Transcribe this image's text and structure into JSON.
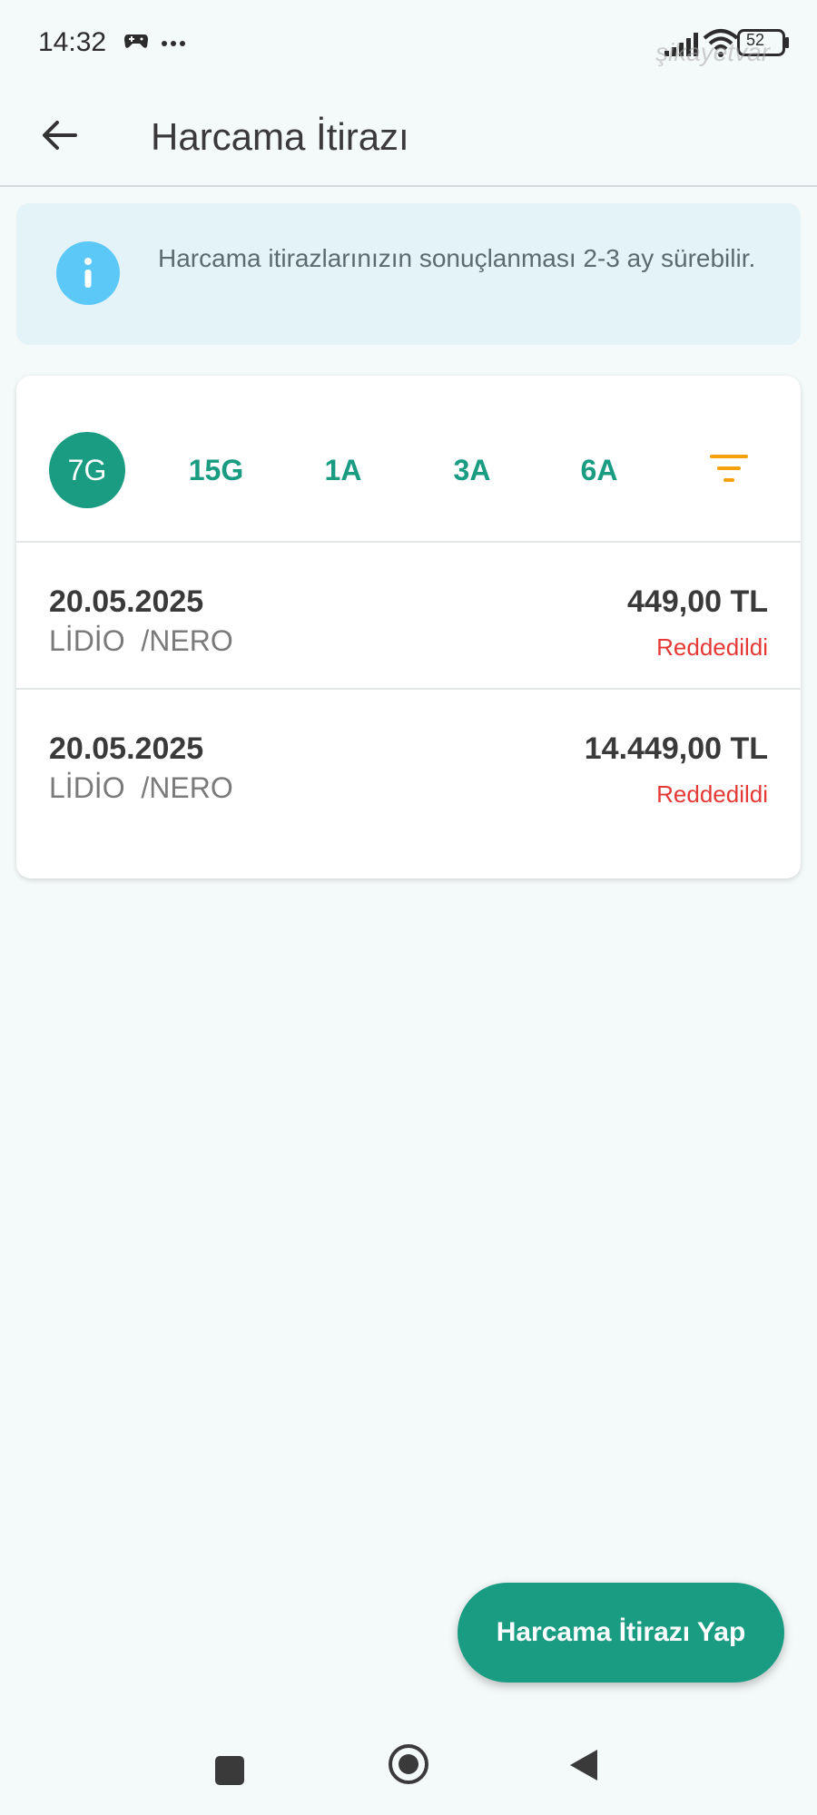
{
  "status_bar": {
    "time": "14:32",
    "battery": "52",
    "icons": [
      "gamepad-icon",
      "more-icon",
      "signal-icon",
      "wifi-icon",
      "battery-icon"
    ]
  },
  "watermark": "şikayetvar",
  "app_bar": {
    "title": "Harcama İtirazı",
    "back_icon": "arrow-left-icon"
  },
  "info_banner": {
    "icon": "info-icon",
    "text": "Harcama itirazlarınızın sonuçlanması 2-3 ay sürebilir."
  },
  "filters": {
    "chips": [
      {
        "label": "7G",
        "active": true
      },
      {
        "label": "15G",
        "active": false
      },
      {
        "label": "1A",
        "active": false
      },
      {
        "label": "3A",
        "active": false
      },
      {
        "label": "6A",
        "active": false
      }
    ],
    "filter_icon": "filter-icon"
  },
  "disputes": [
    {
      "date": "20.05.2025",
      "merchant": "LİDİO  /NERO",
      "amount": "449,00 TL",
      "status": "Reddedildi"
    },
    {
      "date": "20.05.2025",
      "merchant": "LİDİO  /NERO",
      "amount": "14.449,00 TL",
      "status": "Reddedildi"
    }
  ],
  "fab": {
    "label": "Harcama İtirazı Yap"
  },
  "nav_bar": {
    "icons": [
      "recents-icon",
      "home-icon",
      "back-icon"
    ]
  },
  "colors": {
    "accent": "#1a9c82",
    "status_rejected": "#e53935",
    "info_background": "#e3f3f8",
    "info_icon": "#5bc8f7",
    "filter_icon": "#f5a10f",
    "background": "#f4f9f9"
  }
}
